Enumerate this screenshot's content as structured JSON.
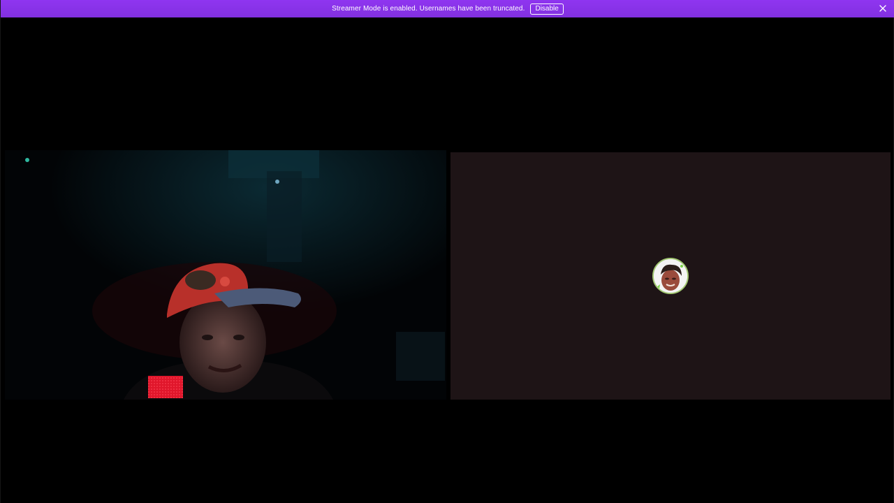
{
  "notice": {
    "text": "Streamer Mode is enabled. Usernames have been truncated.",
    "disable_label": "Disable",
    "bar_color": "#8a2be2"
  },
  "icons": {
    "close": "close-icon"
  },
  "tiles": [
    {
      "kind": "camera-video",
      "state": "camera-on"
    },
    {
      "kind": "avatar",
      "state": "camera-off"
    }
  ]
}
